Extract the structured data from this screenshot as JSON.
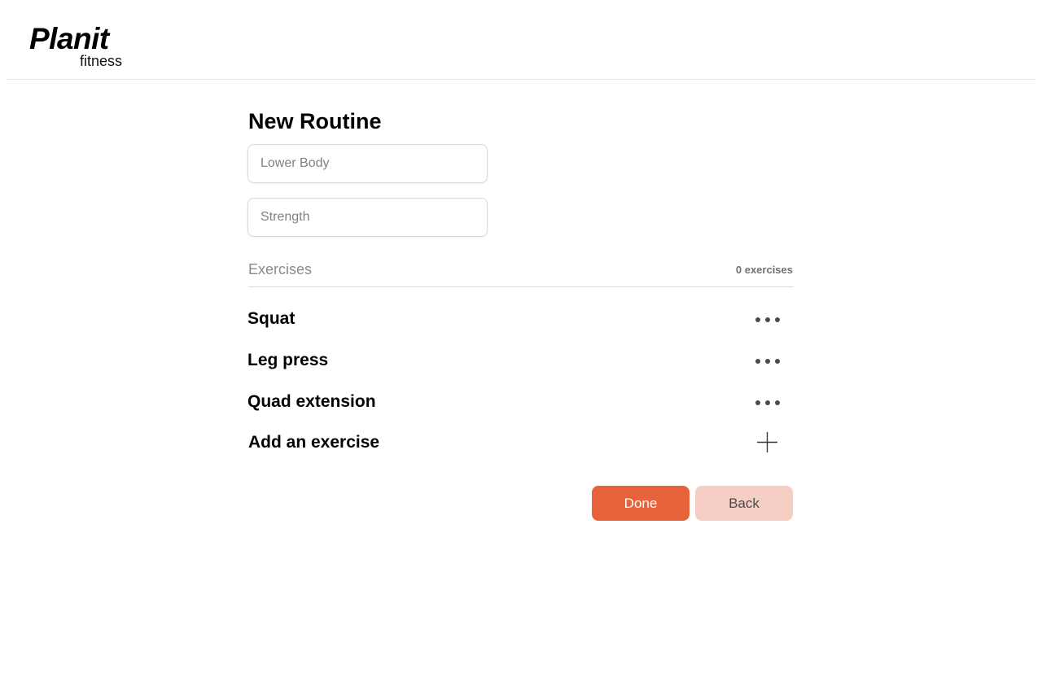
{
  "brand": {
    "name": "Planit",
    "subtitle": "fitness"
  },
  "page": {
    "title": "New Routine"
  },
  "form": {
    "routine_name": {
      "placeholder": "Lower Body",
      "value": ""
    },
    "routine_type": {
      "placeholder": "Strength",
      "value": ""
    }
  },
  "exercises": {
    "section_title": "Exercises",
    "count_label": "0 exercises",
    "items": [
      {
        "name": "Squat",
        "menu_icon": "more-horizontal-icon"
      },
      {
        "name": "Leg press",
        "menu_icon": "more-horizontal-icon"
      },
      {
        "name": "Quad extension",
        "menu_icon": "more-horizontal-icon"
      }
    ],
    "add_label": "Add an exercise",
    "add_icon": "plus-icon"
  },
  "actions": {
    "done_label": "Done",
    "back_label": "Back"
  },
  "colors": {
    "primary": "#e8623c",
    "secondary": "#f5cfc3",
    "text": "#000000",
    "muted": "#8a8a8a"
  }
}
